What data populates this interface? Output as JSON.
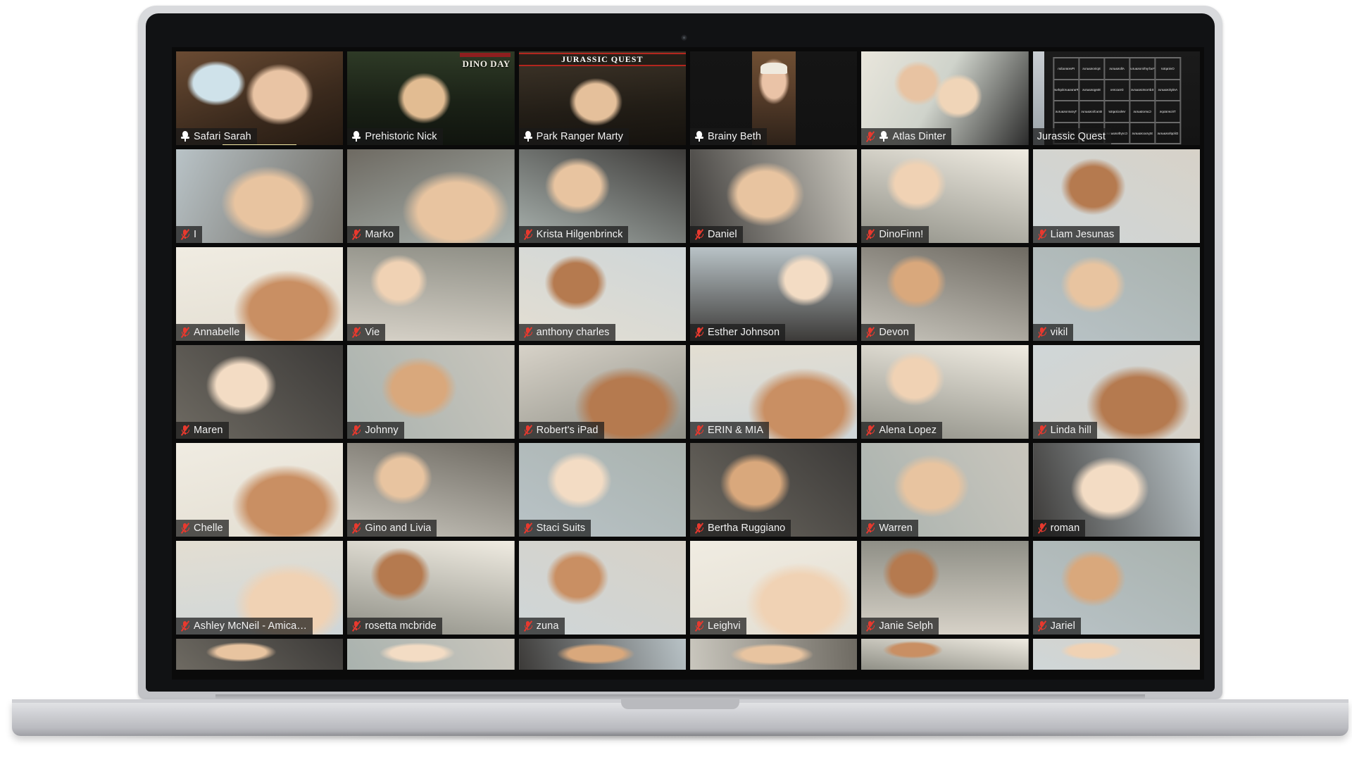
{
  "device": {
    "type": "laptop",
    "camera_label": "webcam"
  },
  "app": {
    "name": "Zoom",
    "view": "gallery-view"
  },
  "colors": {
    "active_speaker_border": "#7ed321",
    "active_speaker_border_outer": "#c8e04a",
    "muted_icon": "#e8392e",
    "name_label_bg": "rgba(25,25,25,0.72)",
    "name_label_text": "#f2f2f2",
    "screen_bg": "#0a0a0a",
    "highlight_underline": "#f4eaa6"
  },
  "gallery": {
    "columns": 6,
    "rows": 7,
    "participants": [
      {
        "name": "Safari Sarah",
        "muted": false,
        "pinned": true,
        "speaking": false,
        "underline": true,
        "bg": "sarah"
      },
      {
        "name": "Prehistoric Nick",
        "muted": false,
        "pinned": true,
        "speaking": false,
        "underline": false,
        "bg": "nick"
      },
      {
        "name": "Park Ranger Marty",
        "muted": false,
        "pinned": true,
        "speaking": false,
        "underline": false,
        "bg": "marty"
      },
      {
        "name": "Brainy Beth",
        "muted": false,
        "pinned": true,
        "speaking": true,
        "underline": false,
        "bg": "beth"
      },
      {
        "name": "Atlas Dinter",
        "muted": true,
        "pinned": true,
        "speaking": false,
        "underline": false,
        "bg": "atlas"
      },
      {
        "name": "Jurassic Quest",
        "muted": false,
        "pinned": false,
        "speaking": false,
        "underline": false,
        "bg": "bingo"
      },
      {
        "name": "I",
        "muted": true,
        "pinned": false,
        "speaking": false,
        "underline": false,
        "bg": "kid1"
      },
      {
        "name": "Marko",
        "muted": true,
        "pinned": false,
        "speaking": false,
        "underline": false,
        "bg": "kid2"
      },
      {
        "name": "Krista Hilgenbrinck",
        "muted": true,
        "pinned": false,
        "speaking": false,
        "underline": false,
        "bg": "kid3"
      },
      {
        "name": "Daniel",
        "muted": true,
        "pinned": false,
        "speaking": false,
        "underline": false,
        "bg": "kid4"
      },
      {
        "name": "DinoFinn!",
        "muted": true,
        "pinned": false,
        "speaking": false,
        "underline": false,
        "bg": "kid5"
      },
      {
        "name": "Liam Jesunas",
        "muted": true,
        "pinned": false,
        "speaking": false,
        "underline": false,
        "bg": "kid6"
      },
      {
        "name": "Annabelle",
        "muted": true,
        "pinned": false,
        "speaking": false,
        "underline": false,
        "bg": "kid7"
      },
      {
        "name": "Vie",
        "muted": true,
        "pinned": false,
        "speaking": false,
        "underline": false,
        "bg": "kid8"
      },
      {
        "name": "anthony charles",
        "muted": true,
        "pinned": false,
        "speaking": false,
        "underline": false,
        "bg": "kid9"
      },
      {
        "name": "Esther Johnson",
        "muted": true,
        "pinned": false,
        "speaking": false,
        "underline": false,
        "bg": "kid10"
      },
      {
        "name": "Devon",
        "muted": true,
        "pinned": false,
        "speaking": false,
        "underline": false,
        "bg": "kid11"
      },
      {
        "name": "vikil",
        "muted": true,
        "pinned": false,
        "speaking": false,
        "underline": false,
        "bg": "kid12"
      },
      {
        "name": "Maren",
        "muted": true,
        "pinned": false,
        "speaking": false,
        "underline": false,
        "bg": "kid13"
      },
      {
        "name": "Johnny",
        "muted": true,
        "pinned": false,
        "speaking": false,
        "underline": false,
        "bg": "kid14"
      },
      {
        "name": "Robert's iPad",
        "muted": true,
        "pinned": false,
        "speaking": false,
        "underline": false,
        "bg": "kid15"
      },
      {
        "name": "ERIN & MIA",
        "muted": true,
        "pinned": false,
        "speaking": false,
        "underline": false,
        "bg": "kid16"
      },
      {
        "name": "Alena Lopez",
        "muted": true,
        "pinned": false,
        "speaking": false,
        "underline": false,
        "bg": "kid17"
      },
      {
        "name": "Linda hill",
        "muted": true,
        "pinned": false,
        "speaking": false,
        "underline": false,
        "bg": "kid18"
      },
      {
        "name": "Chelle",
        "muted": true,
        "pinned": false,
        "speaking": false,
        "underline": false,
        "bg": "kid19"
      },
      {
        "name": "Gino and Livia",
        "muted": true,
        "pinned": false,
        "speaking": false,
        "underline": false,
        "bg": "kid20"
      },
      {
        "name": "Staci Suits",
        "muted": true,
        "pinned": false,
        "speaking": false,
        "underline": false,
        "bg": "kid21"
      },
      {
        "name": "Bertha Ruggiano",
        "muted": true,
        "pinned": false,
        "speaking": false,
        "underline": false,
        "bg": "kid22"
      },
      {
        "name": "Warren",
        "muted": true,
        "pinned": false,
        "speaking": false,
        "underline": false,
        "bg": "kid23"
      },
      {
        "name": "roman",
        "muted": true,
        "pinned": false,
        "speaking": false,
        "underline": false,
        "bg": "kid24"
      },
      {
        "name": "Ashley McNeil - Amica…",
        "muted": true,
        "pinned": false,
        "speaking": false,
        "underline": false,
        "bg": "kid25"
      },
      {
        "name": "rosetta mcbride",
        "muted": true,
        "pinned": false,
        "speaking": false,
        "underline": false,
        "bg": "kid26"
      },
      {
        "name": "zuna",
        "muted": true,
        "pinned": false,
        "speaking": false,
        "underline": false,
        "bg": "kid27"
      },
      {
        "name": "Leighvi",
        "muted": true,
        "pinned": false,
        "speaking": false,
        "underline": false,
        "bg": "kid28"
      },
      {
        "name": "Janie Selph",
        "muted": true,
        "pinned": false,
        "speaking": false,
        "underline": false,
        "bg": "kid29"
      },
      {
        "name": "Jariel",
        "muted": true,
        "pinned": false,
        "speaking": false,
        "underline": false,
        "bg": "kid30"
      },
      {
        "name": "",
        "muted": false,
        "pinned": false,
        "speaking": false,
        "underline": false,
        "bg": "kid31",
        "clipped": true
      },
      {
        "name": "",
        "muted": false,
        "pinned": false,
        "speaking": false,
        "underline": false,
        "bg": "kid32",
        "clipped": true
      },
      {
        "name": "",
        "muted": false,
        "pinned": false,
        "speaking": false,
        "underline": false,
        "bg": "kid33",
        "clipped": true
      },
      {
        "name": "",
        "muted": false,
        "pinned": false,
        "speaking": false,
        "underline": false,
        "bg": "kid34",
        "clipped": true
      },
      {
        "name": "",
        "muted": false,
        "pinned": false,
        "speaking": false,
        "underline": false,
        "bg": "kid35",
        "clipped": true
      },
      {
        "name": "",
        "muted": false,
        "pinned": false,
        "speaking": false,
        "underline": false,
        "bg": "kid36",
        "clipped": true
      }
    ]
  },
  "overlays": {
    "nick_banner": "DINO DAY",
    "marty_banner": "JURASSIC QUEST",
    "bingo_card_title": "Jurassic Quest",
    "bingo_words": [
      [
        "Oviraptor",
        "Pachyrhinosaurus",
        "Allosaurus",
        "Spinosaurus",
        "Pteranodon"
      ],
      [
        "Ankylosaurus",
        "Edmontosaurus",
        "Dracorex",
        "Stegosaurus",
        "Parasaurolophus"
      ],
      [
        "Triceratops",
        "Carnotaurus",
        "Velociraptor",
        "Brachiosaurus",
        "Tyrannosaurus"
      ],
      [
        "Dilophosaurus",
        "Styracosaurus",
        "Corythosaurus",
        "Apatosaurus",
        "Iguanodon"
      ]
    ]
  }
}
